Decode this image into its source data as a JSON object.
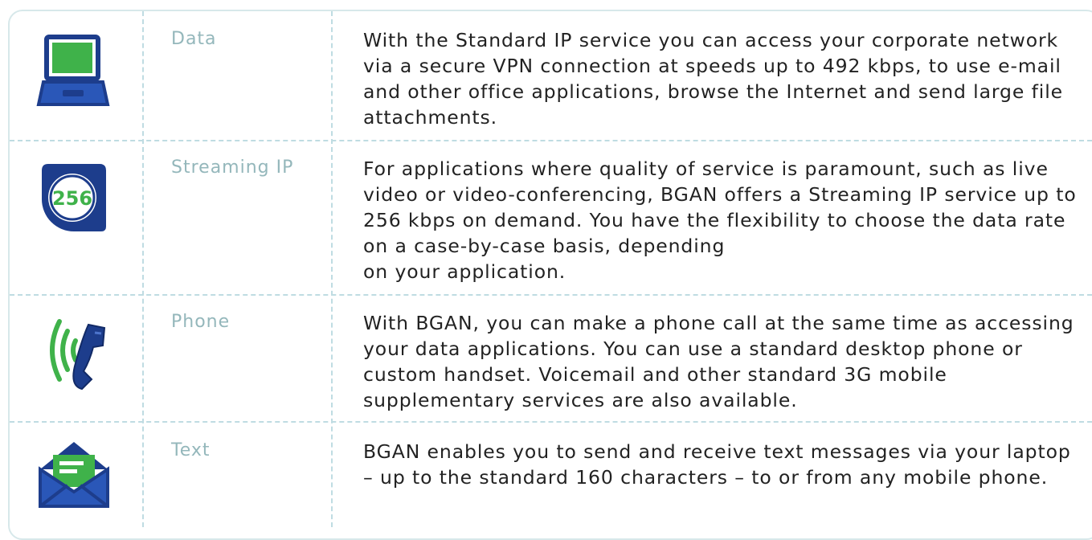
{
  "services": [
    {
      "icon": "laptop-icon",
      "title": "Data",
      "description": "With the Standard IP service you can access your corporate network via a secure VPN connection at speeds up to 492 kbps, to use e-mail and other office applications, browse the Internet and send large file attachments."
    },
    {
      "icon": "streaming-256-icon",
      "icon_text": "256",
      "title": "Streaming IP",
      "description": "For applications where quality of service is paramount, such as live video or video-conferencing, BGAN offers a Streaming IP service up to 256 kbps on demand. You have the flexibility to choose the data rate on a case-by-case basis, depending\non your application."
    },
    {
      "icon": "phone-icon",
      "title": "Phone",
      "description": "With BGAN, you can make a phone call at the same time as accessing your data applications. You can use a standard desktop phone or custom handset. Voicemail and other standard 3G mobile supplementary services are also available."
    },
    {
      "icon": "envelope-icon",
      "title": "Text",
      "description": "BGAN enables you to send and receive text messages via your laptop – up to the standard 160 characters – to or from any mobile phone."
    }
  ],
  "colors": {
    "icon_navy": "#1d3d8c",
    "icon_green": "#3fb24a",
    "title": "#94b7bb",
    "divider": "#bfdce2"
  }
}
